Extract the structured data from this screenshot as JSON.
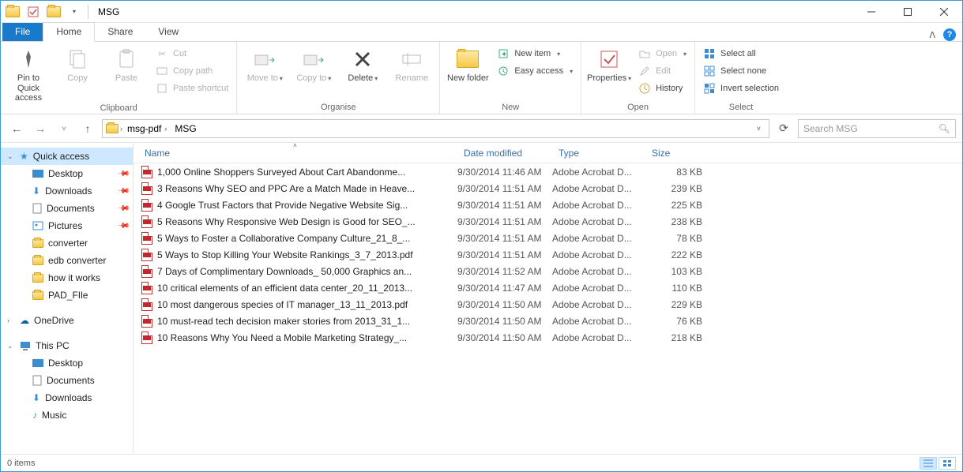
{
  "title": "MSG",
  "tabs": {
    "file": "File",
    "home": "Home",
    "share": "Share",
    "view": "View"
  },
  "ribbon": {
    "clipboard": {
      "label": "Clipboard",
      "pin": "Pin to Quick access",
      "copy": "Copy",
      "paste": "Paste",
      "cut": "Cut",
      "copy_path": "Copy path",
      "paste_shortcut": "Paste shortcut"
    },
    "organise": {
      "label": "Organise",
      "move_to": "Move to",
      "copy_to": "Copy to",
      "delete": "Delete",
      "rename": "Rename"
    },
    "new": {
      "label": "New",
      "new_folder": "New folder",
      "new_item": "New item",
      "easy_access": "Easy access"
    },
    "open": {
      "label": "Open",
      "properties": "Properties",
      "open": "Open",
      "edit": "Edit",
      "history": "History"
    },
    "select": {
      "label": "Select",
      "select_all": "Select all",
      "select_none": "Select none",
      "invert": "Invert selection"
    }
  },
  "breadcrumbs": [
    "msg-pdf",
    "MSG"
  ],
  "search_placeholder": "Search MSG",
  "nav": {
    "quick_access": "Quick access",
    "desktop": "Desktop",
    "downloads": "Downloads",
    "documents": "Documents",
    "pictures": "Pictures",
    "converter": "converter",
    "edb_converter": "edb converter",
    "how_it_works": "how it works",
    "pad_file": "PAD_FIle",
    "onedrive": "OneDrive",
    "this_pc": "This PC",
    "desktop2": "Desktop",
    "documents2": "Documents",
    "downloads2": "Downloads",
    "music": "Music"
  },
  "columns": {
    "name": "Name",
    "date": "Date modified",
    "type": "Type",
    "size": "Size"
  },
  "files": [
    {
      "name": "1,000 Online Shoppers Surveyed About Cart Abandonme...",
      "date": "9/30/2014 11:46 AM",
      "type": "Adobe Acrobat D...",
      "size": "83 KB"
    },
    {
      "name": "3 Reasons Why SEO and PPC Are a Match Made in Heave...",
      "date": "9/30/2014 11:51 AM",
      "type": "Adobe Acrobat D...",
      "size": "239 KB"
    },
    {
      "name": "4 Google Trust Factors that Provide Negative Website Sig...",
      "date": "9/30/2014 11:51 AM",
      "type": "Adobe Acrobat D...",
      "size": "225 KB"
    },
    {
      "name": "5 Reasons Why Responsive Web Design is Good for SEO_...",
      "date": "9/30/2014 11:51 AM",
      "type": "Adobe Acrobat D...",
      "size": "238 KB"
    },
    {
      "name": "5 Ways to Foster a Collaborative Company Culture_21_8_...",
      "date": "9/30/2014 11:51 AM",
      "type": "Adobe Acrobat D...",
      "size": "78 KB"
    },
    {
      "name": "5 Ways to Stop Killing Your Website Rankings_3_7_2013.pdf",
      "date": "9/30/2014 11:51 AM",
      "type": "Adobe Acrobat D...",
      "size": "222 KB"
    },
    {
      "name": "7 Days of Complimentary Downloads_ 50,000 Graphics an...",
      "date": "9/30/2014 11:52 AM",
      "type": "Adobe Acrobat D...",
      "size": "103 KB"
    },
    {
      "name": "10 critical elements of an efficient data center_20_11_2013...",
      "date": "9/30/2014 11:47 AM",
      "type": "Adobe Acrobat D...",
      "size": "110 KB"
    },
    {
      "name": "10 most dangerous species of IT manager_13_11_2013.pdf",
      "date": "9/30/2014 11:50 AM",
      "type": "Adobe Acrobat D...",
      "size": "229 KB"
    },
    {
      "name": "10 must-read tech decision maker stories from 2013_31_1...",
      "date": "9/30/2014 11:50 AM",
      "type": "Adobe Acrobat D...",
      "size": "76 KB"
    },
    {
      "name": "10 Reasons Why You Need a Mobile Marketing Strategy_...",
      "date": "9/30/2014 11:50 AM",
      "type": "Adobe Acrobat D...",
      "size": "218 KB"
    }
  ],
  "status": "0 items"
}
